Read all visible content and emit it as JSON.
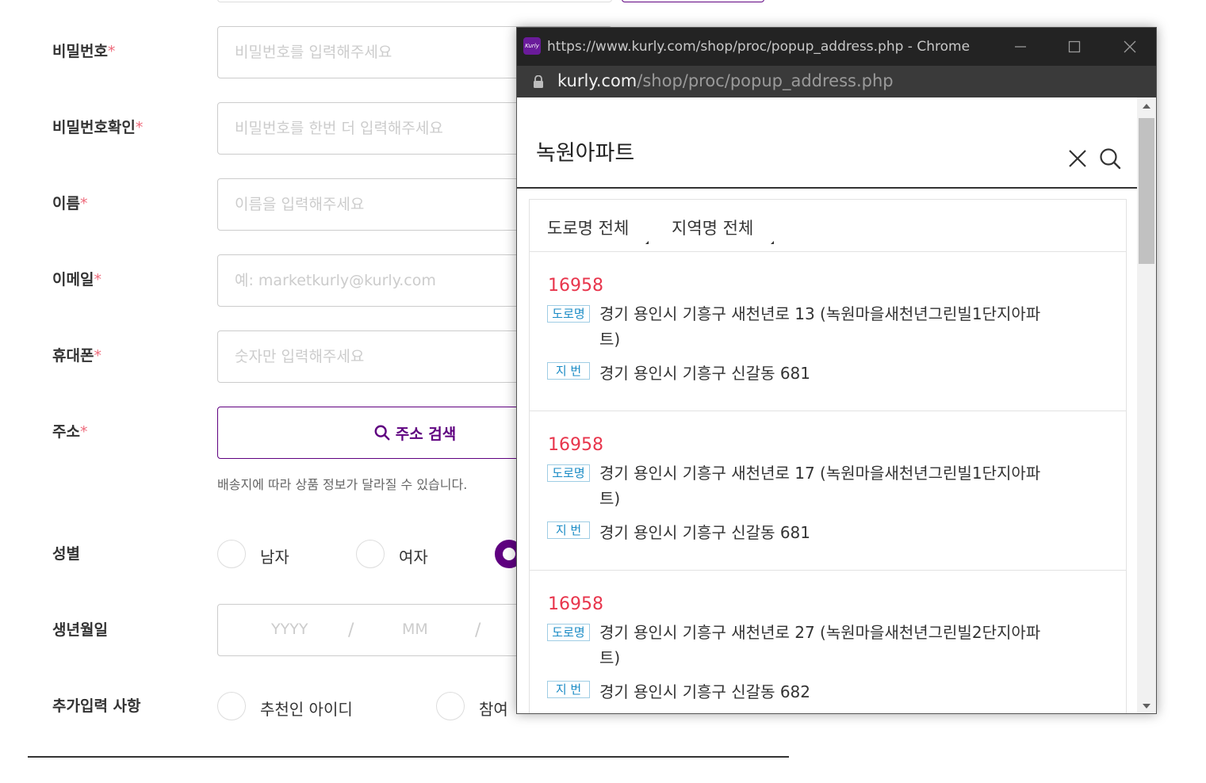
{
  "form": {
    "password": {
      "label": "비밀번호",
      "required_mark": "*",
      "placeholder": "비밀번호를 입력해주세요"
    },
    "password_confirm": {
      "label": "비밀번호확인",
      "required_mark": "*",
      "placeholder": "비밀번호를 한번 더 입력해주세요"
    },
    "name": {
      "label": "이름",
      "required_mark": "*",
      "placeholder": "이름을 입력해주세요"
    },
    "email": {
      "label": "이메일",
      "required_mark": "*",
      "placeholder": "예: marketkurly@kurly.com"
    },
    "phone": {
      "label": "휴대폰",
      "required_mark": "*",
      "placeholder": "숫자만 입력해주세요"
    },
    "address": {
      "label": "주소",
      "required_mark": "*",
      "button_label": "주소 검색",
      "note": "배송지에 따라 상품 정보가 달라질 수 있습니다."
    },
    "gender": {
      "label": "성별",
      "options": [
        "남자",
        "여자"
      ],
      "selected": "third-option"
    },
    "birth": {
      "label": "생년월일",
      "year_placeholder": "YYYY",
      "month_placeholder": "MM",
      "separator": "/"
    },
    "extra": {
      "label": "추가입력 사항",
      "options": [
        "추천인 아이디",
        "참여"
      ]
    }
  },
  "popup": {
    "favicon_text": "Kurly",
    "window_title": "https://www.kurly.com/shop/proc/popup_address.php - Chrome",
    "url_host": "kurly.com",
    "url_path": "/shop/proc/popup_address.php",
    "search_value": "녹원아파트",
    "filters": [
      "도로명 전체",
      "지역명 전체"
    ],
    "road_badge": "도로명",
    "lot_badge": "지 번",
    "results": [
      {
        "zip": "16958",
        "road_line1": "경기 용인시 기흥구 새천년로 13 (녹원마을새천년그린빌1단지아파",
        "road_line2": "트)",
        "lot": "경기 용인시 기흥구 신갈동 681"
      },
      {
        "zip": "16958",
        "road_line1": "경기 용인시 기흥구 새천년로 17 (녹원마을새천년그린빌1단지아파",
        "road_line2": "트)",
        "lot": "경기 용인시 기흥구 신갈동 681"
      },
      {
        "zip": "16958",
        "road_line1": "경기 용인시 기흥구 새천년로 27 (녹원마을새천년그린빌2단지아파",
        "road_line2": "트)",
        "lot": "경기 용인시 기흥구 신갈동 682"
      }
    ]
  },
  "colors": {
    "brand_purple": "#5f0080",
    "zip_red": "#e8354c",
    "badge_blue": "#1a8bc5",
    "required_pink": "#ee6a7b"
  }
}
